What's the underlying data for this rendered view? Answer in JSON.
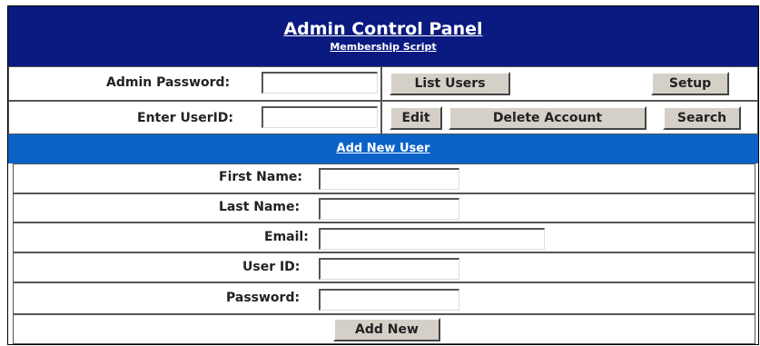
{
  "header": {
    "title": "Admin Control Panel",
    "subtitle": "Membership Script"
  },
  "admin_row": {
    "password_label": "Admin Password:",
    "password_value": "",
    "list_users_label": "List Users",
    "setup_label": "Setup"
  },
  "user_row": {
    "userid_label": "Enter UserID:",
    "userid_value": "",
    "edit_label": "Edit",
    "delete_label": "Delete Account",
    "search_label": "Search"
  },
  "add_user": {
    "heading": "Add New User",
    "fields": {
      "first_name": "First Name:",
      "last_name": "Last Name:",
      "email": "Email:",
      "user_id": "User ID:",
      "password": "Password:"
    },
    "submit_label": "Add New"
  },
  "colors": {
    "header_bg": "#0a1a80",
    "subheader_bg": "#0b63c8",
    "button_face": "#d4d0c8"
  }
}
